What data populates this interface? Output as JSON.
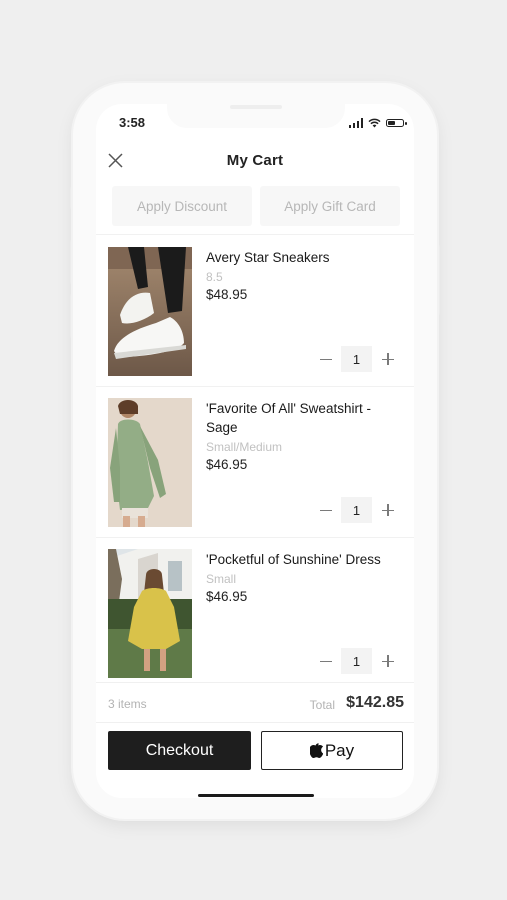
{
  "status_bar": {
    "time": "3:58"
  },
  "header": {
    "title": "My Cart",
    "close_icon": "close-icon"
  },
  "promo": {
    "discount_label": "Apply Discount",
    "gift_card_label": "Apply Gift Card"
  },
  "items": [
    {
      "name": "Avery Star Sneakers",
      "variant": "8.5",
      "price": "$48.95",
      "quantity": "1"
    },
    {
      "name": "'Favorite Of All' Sweatshirt - Sage",
      "variant": "Small/Medium",
      "price": "$46.95",
      "quantity": "1"
    },
    {
      "name": "'Pocketful of Sunshine' Dress",
      "variant": "Small",
      "price": "$46.95",
      "quantity": "1"
    }
  ],
  "summary": {
    "count": "3 items",
    "total_label": "Total",
    "total_value": "$142.85"
  },
  "actions": {
    "checkout_label": "Checkout",
    "applepay_label": "Pay"
  },
  "colors": {
    "checkout_bg": "#1e1e1e",
    "muted_text": "#b7b7b7"
  }
}
